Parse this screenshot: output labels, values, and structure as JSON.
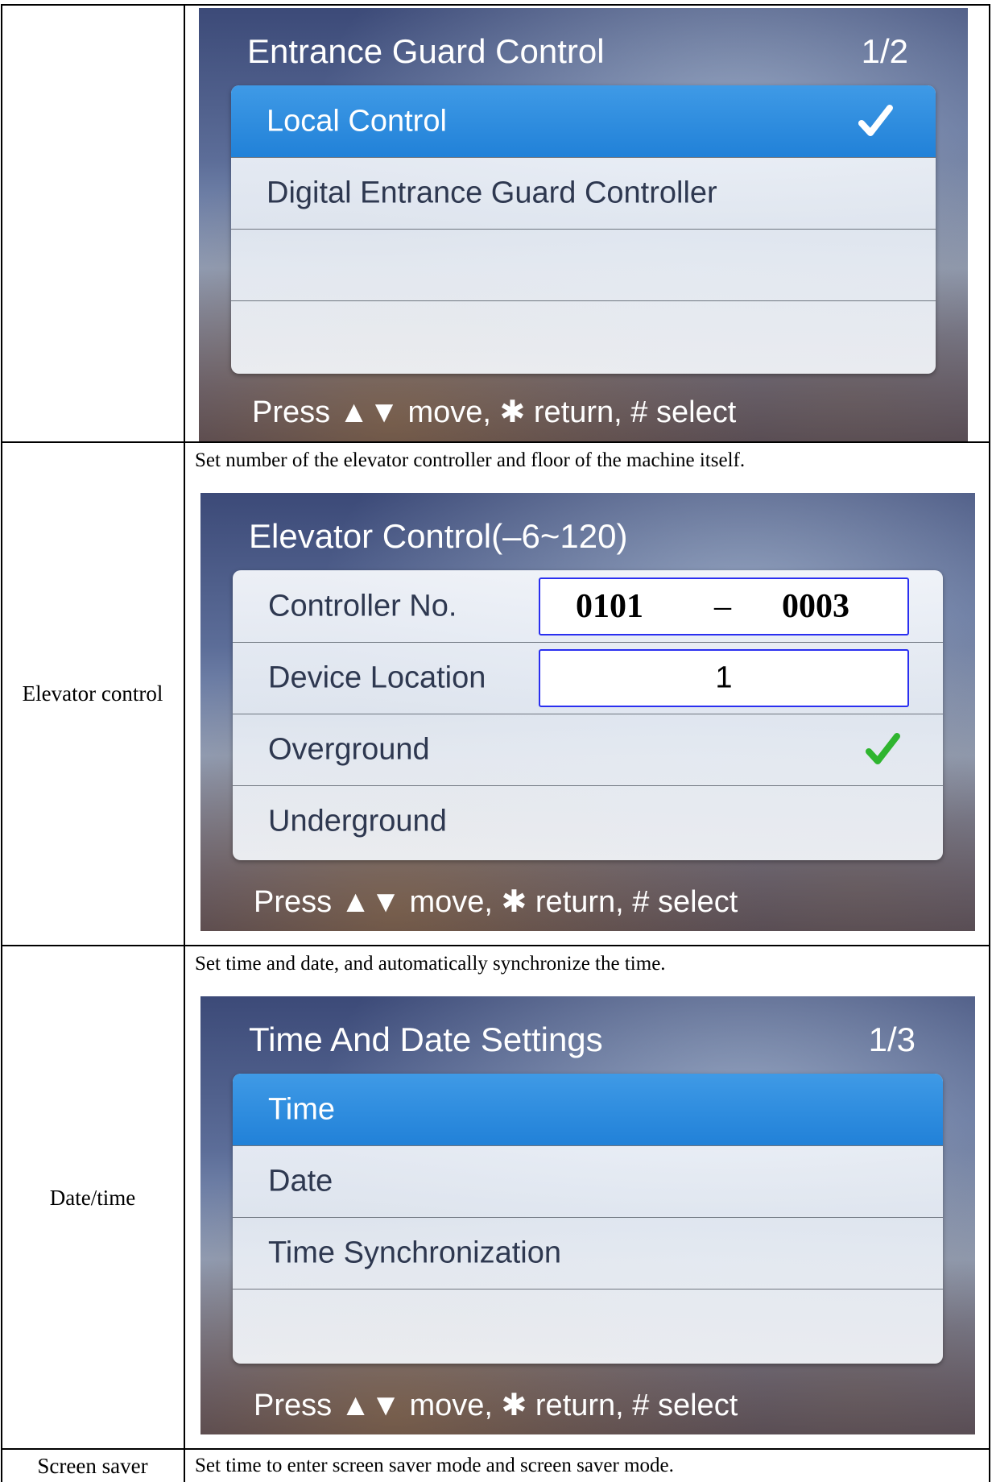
{
  "rows": [
    {
      "label": "",
      "description": "",
      "panel": {
        "title": "Entrance Guard Control",
        "page": "1/2",
        "items": [
          "Local Control",
          "Digital Entrance Guard Controller",
          "",
          ""
        ],
        "selected_index": 0,
        "checked_index": 0,
        "hint": "Press ▲▼ move, ✱ return, # select"
      }
    },
    {
      "label": "Elevator control",
      "description": "Set number of the elevator controller and floor of the machine itself.",
      "panel": {
        "title": "Elevator Control(–6~120)",
        "items": [
          "Controller No.",
          "Device Location",
          "Overground",
          "Underground"
        ],
        "controller_no": {
          "part1": "0101",
          "separator": "–",
          "part2": "0003"
        },
        "device_location": "1",
        "checked_index": 2,
        "hint": "Press ▲▼ move, ✱ return, # select"
      }
    },
    {
      "label": "Date/time",
      "description": "Set time and date, and automatically synchronize the time.",
      "panel": {
        "title": "Time And Date Settings",
        "page": "1/3",
        "items": [
          "Time",
          "Date",
          "Time Synchronization",
          ""
        ],
        "selected_index": 0,
        "hint": "Press ▲▼ move, ✱ return, # select"
      }
    },
    {
      "label": "Screen saver",
      "description": "Set time to enter screen saver mode and screen saver mode."
    }
  ],
  "colors": {
    "selection_blue": "#2a88dc",
    "check_white": "#ffffff",
    "check_green": "#2fb52f",
    "field_border": "#2a2ff0"
  },
  "icons": {
    "check": "checkmark-icon",
    "up_down": "up-down-triangles-icon",
    "asterisk": "asterisk-icon"
  }
}
